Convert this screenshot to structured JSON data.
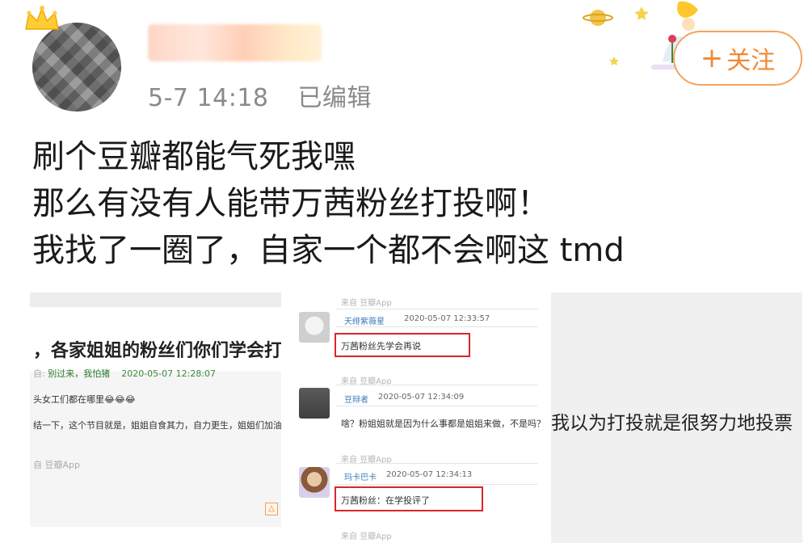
{
  "header": {
    "time": "5-7 14:18",
    "edited": "已编辑",
    "follow_label": "关注",
    "follow_plus": "+"
  },
  "post": {
    "lines": [
      "刷个豆瓣都能气死我嘿",
      "那么有没有人能带万茜粉丝打投啊！",
      "我找了一圈了，自家一个都不会啊这 tmd"
    ]
  },
  "image1": {
    "title": "，各家姐姐的粉丝们你们学会打投了",
    "author_prefix": "自: ",
    "author": "别过来，我怕猪",
    "date": "2020-05-07 12:28:07",
    "line1": "头女工们都在哪里😂😂😂",
    "line2": "结一下，这个节目就是，姐姐自食其力，自力更生，姐姐们加油！",
    "source": "自 豆瓣App"
  },
  "image2": {
    "top_source": "来自 豆瓣App",
    "comments": [
      {
        "nick": "天绯紫薇星",
        "time": "2020-05-07 12:33:57",
        "text": "万茜粉丝先学会再说",
        "source": "来自 豆瓣App"
      },
      {
        "nick": "豆辩者",
        "time": "2020-05-07 12:34:09",
        "text": "啥？粉姐姐就是因为什么事都是姐姐来做，不是吗？",
        "source": "来自 豆瓣App"
      },
      {
        "nick": "玛卡巴卡",
        "time": "2020-05-07 12:34:13",
        "text": "万茜粉丝：在学投评了",
        "source": "来自 豆瓣App"
      }
    ]
  },
  "image3": {
    "text": "我以为打投就是很努力地投票"
  },
  "colors": {
    "accent": "#f08a33",
    "highlight_box": "#d9262c",
    "meta": "#8a8a8a"
  }
}
